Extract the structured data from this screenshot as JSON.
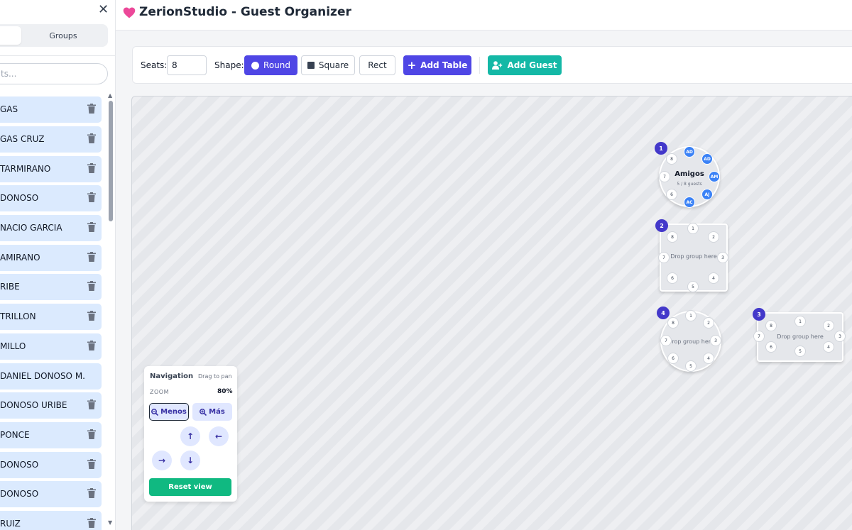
{
  "app": {
    "title": "ZerionStudio - Guest Organizer"
  },
  "sidebar": {
    "close_icon": "close-icon",
    "tabs": [
      {
        "label": ""
      },
      {
        "label": "Groups"
      }
    ],
    "search": {
      "placeholder": "ts..."
    },
    "items": [
      {
        "label": "GAS"
      },
      {
        "label": "GAS CRUZ"
      },
      {
        "label": "TARMIRANO"
      },
      {
        "label": "DONOSO"
      },
      {
        "label": "NACIO GARCIA"
      },
      {
        "label": "AMIRANO"
      },
      {
        "label": "RIBE"
      },
      {
        "label": "TRILLON"
      },
      {
        "label": "MILLO"
      },
      {
        "label": "DANIEL DONOSO M..."
      },
      {
        "label": "DONOSO URIBE"
      },
      {
        "label": "PONCE"
      },
      {
        "label": "DONOSO"
      },
      {
        "label": "DONOSO"
      },
      {
        "label": "RUIZ"
      }
    ]
  },
  "toolbar": {
    "seats_label": "Seats:",
    "seats_value": "8",
    "shape_label": "Shape:",
    "round_label": "Round",
    "square_label": "Square",
    "rect_label": "Rect",
    "add_table_label": "Add Table",
    "add_guest_label": "Add Guest"
  },
  "colors": {
    "primary": "#4f46e5",
    "teal": "#14b8a6",
    "green": "#10b981",
    "guest": "#3b82f6",
    "heart": "#ec4899"
  },
  "tables": [
    {
      "number": "1",
      "shape": "round",
      "name": "Amigos",
      "count": "5 / 8 guests",
      "seats": [
        "AD",
        "AD",
        "AM",
        "AJ",
        "AC",
        "6",
        "7",
        "8"
      ],
      "occupied": [
        true,
        true,
        true,
        true,
        true,
        false,
        false,
        false
      ]
    },
    {
      "number": "2",
      "shape": "square",
      "drop": "Drop group here",
      "seats": [
        "1",
        "2",
        "3",
        "4",
        "5",
        "6",
        "7",
        "8"
      ]
    },
    {
      "number": "4",
      "shape": "round",
      "drop": "Drop group here",
      "seats": [
        "1",
        "2",
        "3",
        "4",
        "5",
        "6",
        "7",
        "8"
      ]
    },
    {
      "number": "3",
      "shape": "rect",
      "drop": "Drop group here",
      "seats": [
        "1",
        "2",
        "3",
        "4",
        "5",
        "6",
        "7",
        "8"
      ]
    }
  ],
  "navigation": {
    "title": "Navigation",
    "hint": "Drag to pan",
    "zoom_label": "ZOOM",
    "zoom_value": "80%",
    "zoom_out_label": "Menos",
    "zoom_in_label": "Más",
    "reset_label": "Reset view"
  }
}
